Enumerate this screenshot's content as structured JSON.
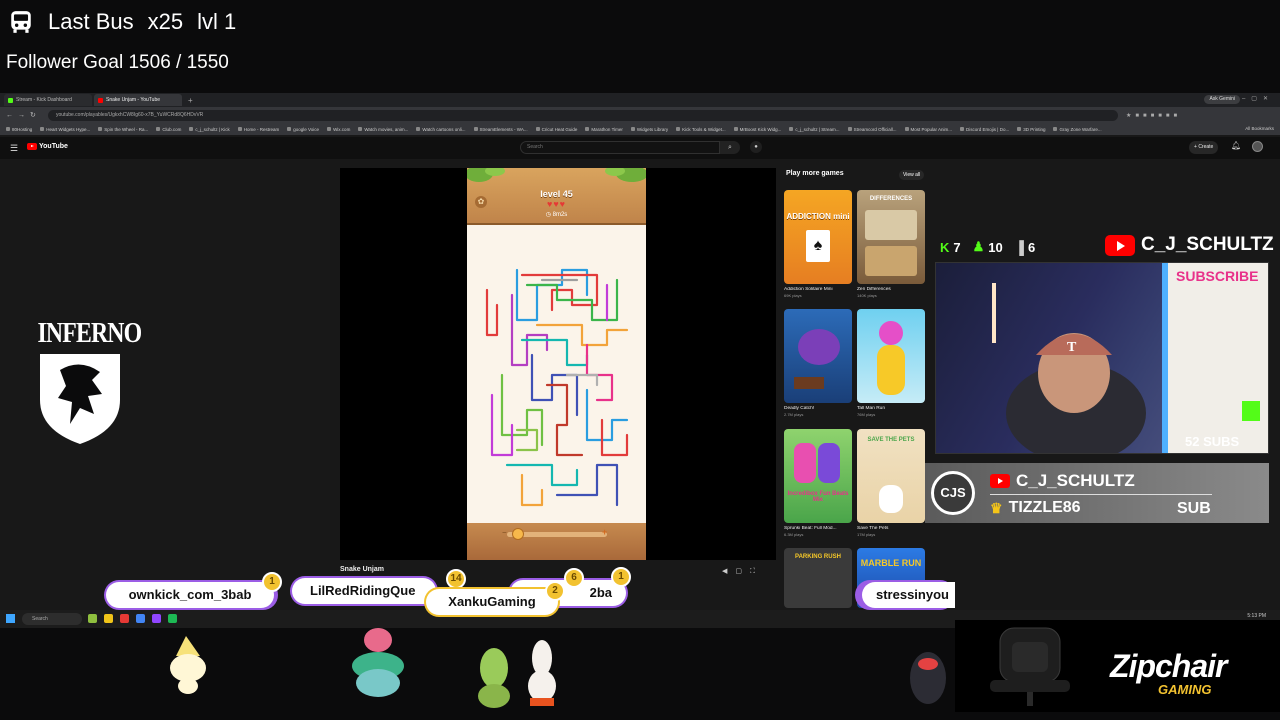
{
  "overlay": {
    "bus_label": "Last Bus",
    "multiplier": "x25",
    "level": "lvl 1",
    "follower_goal": "Follower Goal 1506 / 1550"
  },
  "browser": {
    "tabs": [
      {
        "label": "Stream - Kick Dashboard",
        "color": "#53fc18"
      },
      {
        "label": "Snake Unjam - YouTube",
        "color": "#ff0000"
      }
    ],
    "ask_gemini": "Ask Gemini",
    "url": "youtube.com/playables/UgkxhCW8Ig60-x7B_YuWCRd8Q6HDvVR",
    "bookmarks": [
      "80Hosting",
      "Heart Widgets Hype...",
      "Spin the Wheel - Ra...",
      "Club.com",
      "c_j_schultz | Kick",
      "Home - Restream",
      "google Voice",
      "Wix.com",
      "Watch movies, anim...",
      "Watch cartoons onli...",
      "StreamElements - WA...",
      "Cricut Heat Guide",
      "Marathon Timer",
      "Widgets Library",
      "Kick Tools & Widget...",
      "MrBoost Kick Widg...",
      "c_j_schultz | Stream...",
      "Streamcord Officiall...",
      "Most Popular Anim...",
      "Discord Emojis | Do...",
      "3D Printing",
      "Gray Zone Warfare..."
    ],
    "all_bookmarks": "All Bookmarks"
  },
  "youtube": {
    "logo": "YouTube",
    "search_placeholder": "Search",
    "create_label": "Create",
    "video_title": "Snake Unjam"
  },
  "game": {
    "level": "level 45",
    "hearts": "♥♥♥",
    "timer": "8m2s"
  },
  "sidebar": {
    "title": "Play more games",
    "view_all": "View all",
    "games": [
      {
        "name": "Addiction Solitaire Mini",
        "plays": "69K plays",
        "thumb": "ADDICTION mini"
      },
      {
        "name": "Zen Differences",
        "plays": "140K plays",
        "thumb": "DIFFERENCES"
      },
      {
        "name": "Deadly Catch!",
        "plays": "2.7M plays",
        "thumb": ""
      },
      {
        "name": "Tall Man Run",
        "plays": "76M plays",
        "thumb": ""
      },
      {
        "name": "Sprunki Beat: Full Mod...",
        "plays": "6.3M plays",
        "thumb": "Incredibox Fun Beats Mix"
      },
      {
        "name": "Save The Pets",
        "plays": "17M plays",
        "thumb": "SAVE THE PETS"
      },
      {
        "name": "",
        "plays": "",
        "thumb": "PARKING RUSH"
      },
      {
        "name": "",
        "plays": "",
        "thumb": "MARBLE RUN"
      }
    ]
  },
  "stream": {
    "kick_count": "7",
    "follower_icon_count": "10",
    "viewer_count": "6",
    "channel": "C_J_SCHULTZ",
    "subs": "52 SUBS",
    "sub_panel_channel": "C_J_SCHULTZ",
    "sub_user": "TIZZLE86",
    "sub_tag": "SUB",
    "sub_logo": "CJS"
  },
  "brand": {
    "inferno": "INFERNO",
    "zipchair": "Zipchair",
    "zipchair_sub": "GAMING"
  },
  "chat": [
    {
      "name": "ownkick_com_3bab",
      "badge": "1"
    },
    {
      "name": "LilRedRidingQue",
      "badge": "14"
    },
    {
      "name": "XankuGaming",
      "badge": "2"
    },
    {
      "name": "2ba",
      "badge": "1"
    },
    {
      "name": "stressinyou",
      "badge": ""
    }
  ],
  "chat_extra_badge": "6",
  "taskbar": {
    "search": "Search",
    "tray": "5:13 PM"
  },
  "colors": {
    "youtube_red": "#ff0000",
    "kick_green": "#53fc18",
    "gold": "#f2c230",
    "chat_border_purple": "#9b5de5"
  }
}
